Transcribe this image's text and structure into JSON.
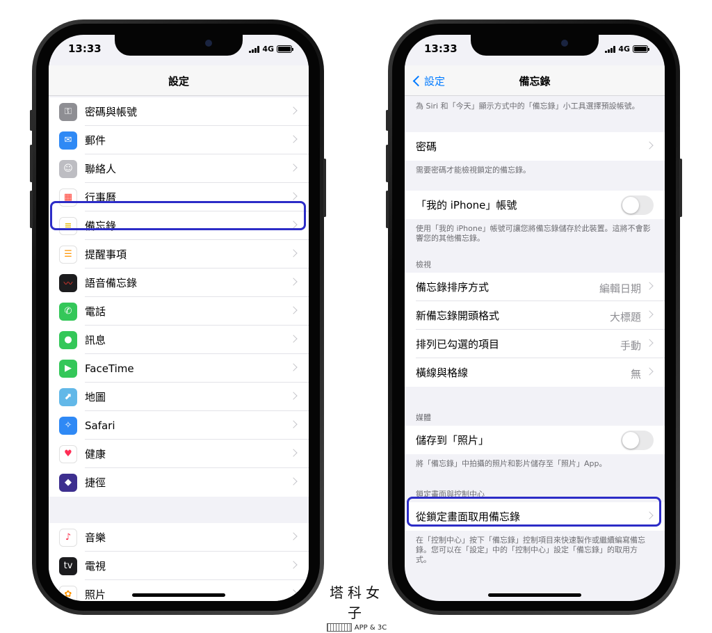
{
  "status_bar": {
    "time": "13:33",
    "network": "4G"
  },
  "left_screen": {
    "title": "設定",
    "group1": [
      {
        "label": "密碼與帳號",
        "icon": "key-icon",
        "color": "#8e8e93"
      },
      {
        "label": "郵件",
        "icon": "mail-icon",
        "color": "#2f89f5"
      },
      {
        "label": "聯絡人",
        "icon": "contacts-icon",
        "color": "#bdbdc2"
      },
      {
        "label": "行事曆",
        "icon": "calendar-icon",
        "color": "#ffffff"
      },
      {
        "label": "備忘錄",
        "icon": "notes-icon",
        "color": "#ffffff"
      },
      {
        "label": "提醒事項",
        "icon": "reminders-icon",
        "color": "#ffffff"
      },
      {
        "label": "語音備忘錄",
        "icon": "voice-memo-icon",
        "color": "#1c1c1e"
      },
      {
        "label": "電話",
        "icon": "phone-icon",
        "color": "#34c759"
      },
      {
        "label": "訊息",
        "icon": "messages-icon",
        "color": "#34c759"
      },
      {
        "label": "FaceTime",
        "icon": "facetime-icon",
        "color": "#34c759"
      },
      {
        "label": "地圖",
        "icon": "maps-icon",
        "color": "#62b8e8"
      },
      {
        "label": "Safari",
        "icon": "safari-icon",
        "color": "#2f89f5"
      },
      {
        "label": "健康",
        "icon": "health-icon",
        "color": "#ffffff"
      },
      {
        "label": "捷徑",
        "icon": "shortcuts-icon",
        "color": "#3d2f8f"
      }
    ],
    "group2": [
      {
        "label": "音樂",
        "icon": "music-icon",
        "color": "#ffffff"
      },
      {
        "label": "電視",
        "icon": "tv-icon",
        "color": "#1c1c1e"
      },
      {
        "label": "照片",
        "icon": "photos-icon",
        "color": "#ffffff"
      }
    ]
  },
  "right_screen": {
    "back_label": "設定",
    "title": "備忘錄",
    "top_note": "為 Siri 和「今天」顯示方式中的「備忘錄」小工具選擇預設帳號。",
    "password_label": "密碼",
    "password_note": "需要密碼才能檢視鎖定的備忘錄。",
    "my_iphone_label": "「我的 iPhone」帳號",
    "my_iphone_note": "使用「我的 iPhone」帳號可讓您將備忘錄儲存於此裝置。這將不會影響您的其他備忘錄。",
    "view_header": "檢視",
    "view_rows": [
      {
        "label": "備忘錄排序方式",
        "value": "編輯日期"
      },
      {
        "label": "新備忘錄開頭格式",
        "value": "大標題"
      },
      {
        "label": "排列已勾選的項目",
        "value": "手動"
      },
      {
        "label": "橫線與格線",
        "value": "無"
      }
    ],
    "media_header": "媒體",
    "save_photos_label": "儲存到「照片」",
    "save_photos_note": "將「備忘錄」中拍攝的照片和影片儲存至「照片」App。",
    "lock_header": "鎖定畫面與控制中心",
    "lock_row_label": "從鎖定畫面取用備忘錄",
    "lock_note": "在「控制中心」按下「備忘錄」控制項目來快速製作或繼續編寫備忘錄。您可以在「設定」中的「控制中心」設定「備忘錄」的取用方式。"
  },
  "watermark": {
    "title": "塔科女子",
    "subtitle": "APP & 3C"
  },
  "colors": {
    "highlight": "#2c2cc7",
    "ios_blue": "#007aff"
  }
}
